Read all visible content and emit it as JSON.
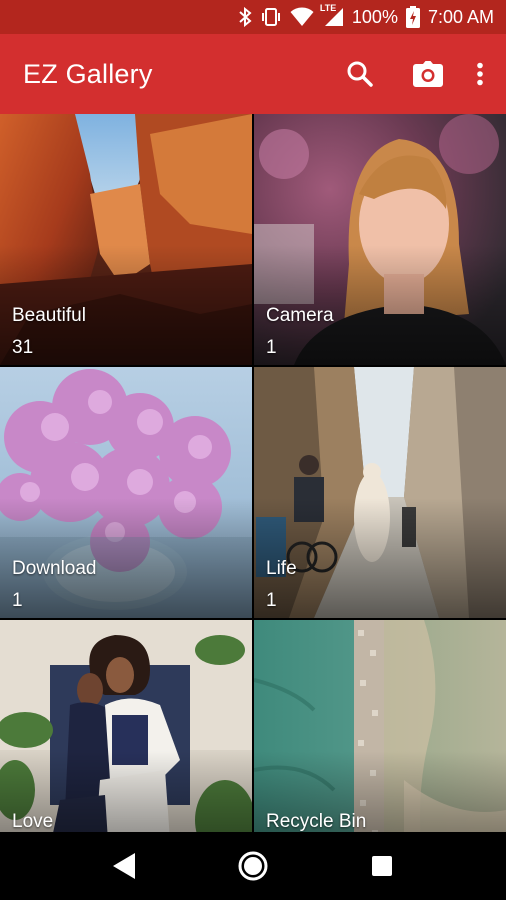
{
  "status_bar": {
    "network_label": "LTE",
    "battery_percent": "100%",
    "time": "7:00 AM",
    "icons": [
      "bluetooth-icon",
      "vibrate-icon",
      "wifi-icon",
      "signal-icon",
      "battery-charging-icon"
    ]
  },
  "app_bar": {
    "title": "EZ Gallery",
    "actions": [
      "search-icon",
      "camera-icon",
      "more-vert-icon"
    ]
  },
  "albums": [
    {
      "name": "Beautiful",
      "count": "31"
    },
    {
      "name": "Camera",
      "count": "1"
    },
    {
      "name": "Download",
      "count": "1"
    },
    {
      "name": "Life",
      "count": "1"
    },
    {
      "name": "Love",
      "count": ""
    },
    {
      "name": "Recycle Bin",
      "count": ""
    }
  ],
  "nav_bar": {
    "buttons": [
      "back-icon",
      "home-icon",
      "recents-icon"
    ]
  },
  "colors": {
    "status_bar": "#b3261e",
    "app_bar": "#d32f2f",
    "nav_bar": "#000000"
  }
}
